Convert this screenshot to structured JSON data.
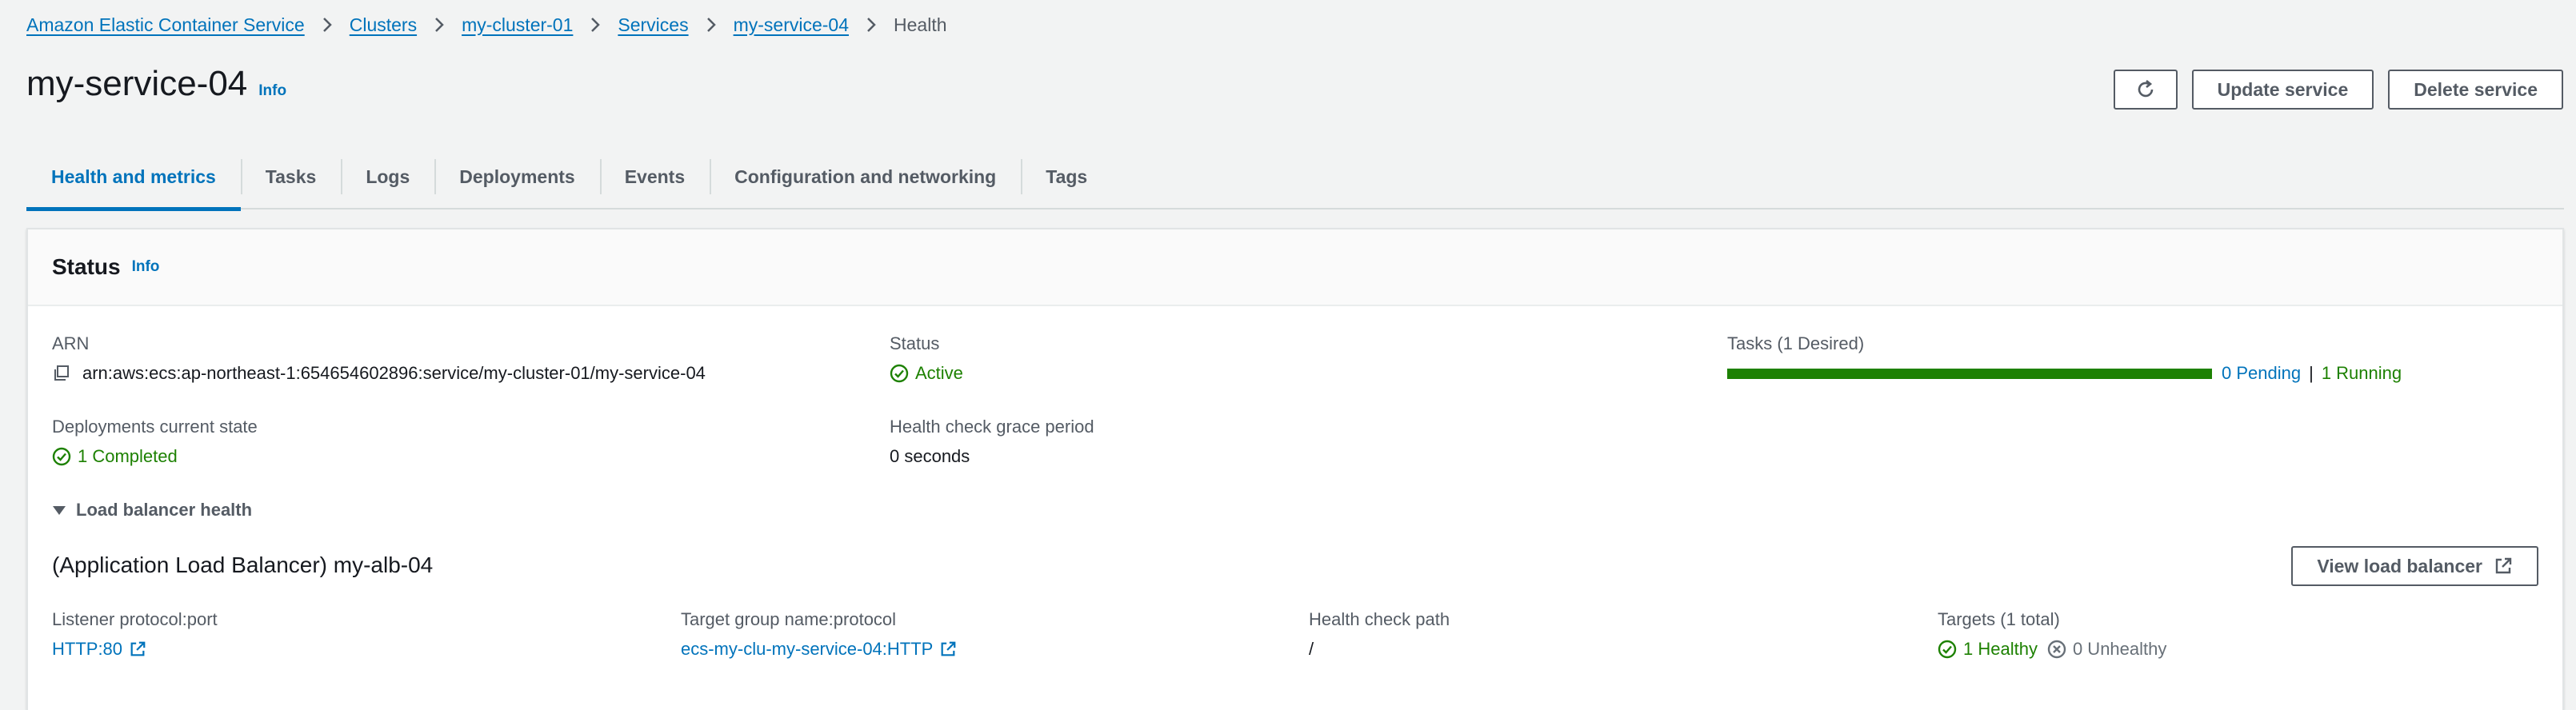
{
  "breadcrumb": {
    "items": [
      "Amazon Elastic Container Service",
      "Clusters",
      "my-cluster-01",
      "Services",
      "my-service-04"
    ],
    "current": "Health"
  },
  "header": {
    "title": "my-service-04",
    "info": "Info",
    "update_label": "Update service",
    "delete_label": "Delete service"
  },
  "tabs": [
    {
      "label": "Health and metrics",
      "active": true
    },
    {
      "label": "Tasks"
    },
    {
      "label": "Logs"
    },
    {
      "label": "Deployments"
    },
    {
      "label": "Events"
    },
    {
      "label": "Configuration and networking"
    },
    {
      "label": "Tags"
    }
  ],
  "status": {
    "title": "Status",
    "info": "Info",
    "arn_label": "ARN",
    "arn_value": "arn:aws:ecs:ap-northeast-1:654654602896:service/my-cluster-01/my-service-04",
    "status_label": "Status",
    "status_value": "Active",
    "tasks_label": "Tasks (1 Desired)",
    "tasks_progress": 1.0,
    "pending": "0 Pending",
    "pipe": "|",
    "running": "1 Running",
    "deploy_label": "Deployments current state",
    "deploy_value": "1 Completed",
    "grace_label": "Health check grace period",
    "grace_value": "0 seconds"
  },
  "lb": {
    "expander": "Load balancer health",
    "title": "(Application Load Balancer) my-alb-04",
    "view_label": "View load balancer",
    "listener_label": "Listener protocol:port",
    "listener_value": "HTTP:80",
    "tg_label": "Target group name:protocol",
    "tg_value": "ecs-my-clu-my-service-04:HTTP",
    "path_label": "Health check path",
    "path_value": "/",
    "targets_label": "Targets (1 total)",
    "healthy": "1 Healthy",
    "unhealthy": "0 Unhealthy"
  },
  "colors": {
    "link": "#0073bb",
    "success": "#1d8102",
    "muted": "#545b64",
    "background": "#f2f3f3"
  }
}
